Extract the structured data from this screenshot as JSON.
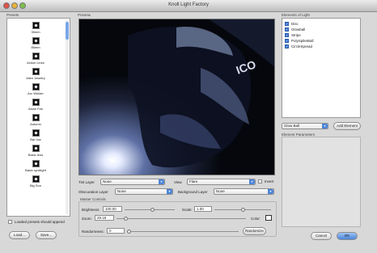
{
  "window": {
    "title": "Knoll Light Factory"
  },
  "presets": {
    "header": "Presets",
    "items": [
      {
        "label": "35mm"
      },
      {
        "label": "85mm"
      },
      {
        "label": "Action Lines"
      },
      {
        "label": "Alien Jewelry"
      },
      {
        "label": "Arc Welder"
      },
      {
        "label": "Asian Fan"
      },
      {
        "label": "Autumn"
      },
      {
        "label": "Bar Iow"
      },
      {
        "label": "Basic lens"
      },
      {
        "label": "Basic spotlight"
      },
      {
        "label": "Big Sun"
      }
    ],
    "append_label": "Loaded presets should append",
    "load_label": "Load...",
    "save_label": "Save..."
  },
  "preview": {
    "header": "Preview"
  },
  "controls": {
    "tint_layer": {
      "label": "Tint Layer",
      "value": "None"
    },
    "view": {
      "label": "View",
      "value": "Flare"
    },
    "invert_label": "Invert",
    "obscuration": {
      "label": "Obscuration Layer",
      "value": "None"
    },
    "background": {
      "label": "Background Layer",
      "value": "None"
    },
    "master_header": "Master Controls",
    "brightness": {
      "label": "Brightness:",
      "value": "100.00"
    },
    "scale": {
      "label": "Scale:",
      "value": "1.00"
    },
    "zoom": {
      "label": "Zoom:",
      "value": "29.18"
    },
    "color_label": "Color:",
    "randomness": {
      "label": "Randomness:",
      "value": "0"
    },
    "randomize_label": "Randomize"
  },
  "elements": {
    "header": "Elements of Light",
    "items": [
      {
        "label": "Disc"
      },
      {
        "label": "Glowball"
      },
      {
        "label": "Stripe"
      },
      {
        "label": "PolySpikeBall"
      },
      {
        "label": "CircleSpread"
      }
    ],
    "add_select_value": "Glow Ball",
    "add_label": "Add Element",
    "params_header": "Element Parameters"
  },
  "footer": {
    "cancel_label": "Cancel",
    "ok_label": "OK"
  },
  "colors": {
    "accent": "#3b78d6"
  }
}
